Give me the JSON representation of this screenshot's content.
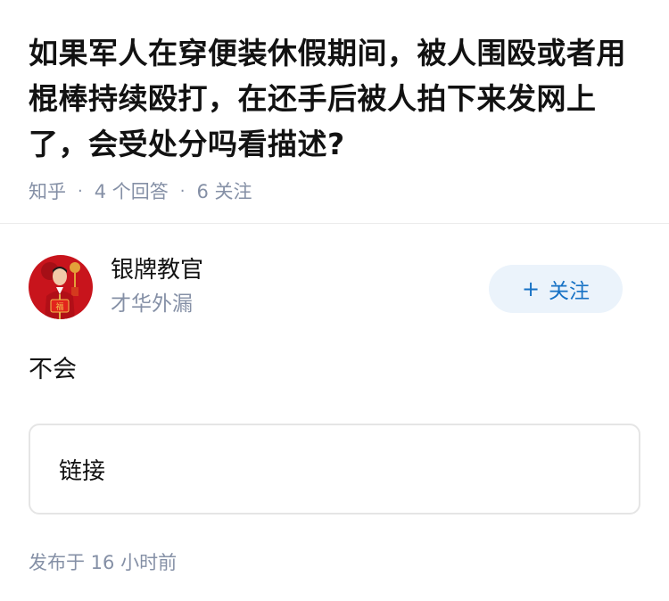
{
  "question": {
    "title": "如果军人在穿便装休假期间，被人围殴或者用棍棒持续殴打，在还手后被人拍下来发网上了，会受处分吗看描述?",
    "source": "知乎",
    "answer_count": "4 个回答",
    "follower_count": "6 关注"
  },
  "answer": {
    "author_name": "银牌教官",
    "author_tagline": "才华外漏",
    "follow_label": "关注",
    "follow_icon": "plus-icon",
    "content": "不会",
    "link_text": "链接",
    "publish_time": "发布于  16 小时前",
    "avatar_badge_text": "福"
  },
  "colors": {
    "title": "#121212",
    "meta": "#8590a6",
    "follow_bg": "#ebf3fb",
    "follow_text": "#1772c5",
    "avatar_bg": "#c8141c"
  }
}
